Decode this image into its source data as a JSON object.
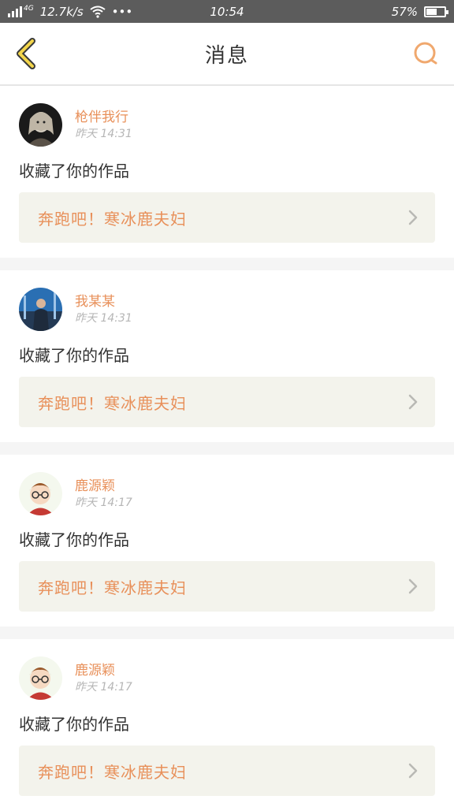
{
  "status_bar": {
    "network": "4G",
    "speed": "12.7k/s",
    "dots": "•••",
    "time": "10:54",
    "battery": "57%",
    "battery_level": 0.57
  },
  "header": {
    "title": "消息",
    "back_icon": "chevron-left-icon",
    "search_icon": "search-icon"
  },
  "colors": {
    "accent": "#e8905a",
    "back_icon": "#f3d54b",
    "search_icon": "#f0a86e",
    "link_bg": "#f3f3ec"
  },
  "messages": [
    {
      "username": "枪伴我行",
      "time": "昨天 14:31",
      "action": "收藏了你的作品",
      "work_title": "奔跑吧！寒冰鹿夫妇",
      "avatar": "dark-art-avatar"
    },
    {
      "username": "我某某",
      "time": "昨天 14:31",
      "action": "收藏了你的作品",
      "work_title": "奔跑吧！寒冰鹿夫妇",
      "avatar": "blue-outdoor-avatar"
    },
    {
      "username": "鹿源颖",
      "time": "昨天 14:17",
      "action": "收藏了你的作品",
      "work_title": "奔跑吧！寒冰鹿夫妇",
      "avatar": "cartoon-glasses-avatar"
    },
    {
      "username": "鹿源颖",
      "time": "昨天 14:17",
      "action": "收藏了你的作品",
      "work_title": "奔跑吧！寒冰鹿夫妇",
      "avatar": "cartoon-glasses-avatar"
    }
  ]
}
